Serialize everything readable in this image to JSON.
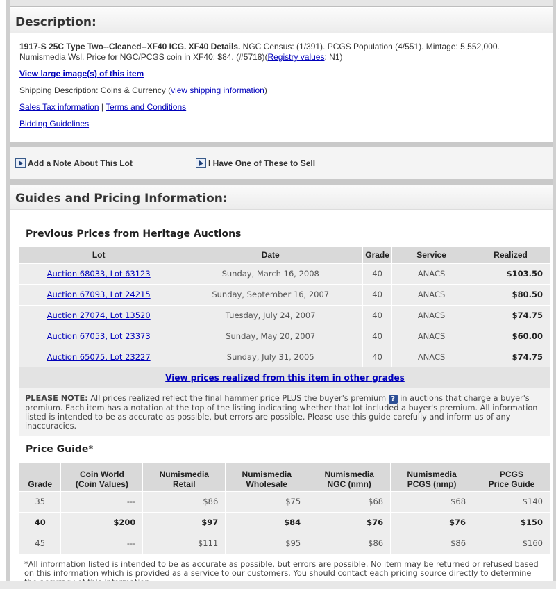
{
  "description": {
    "title": "Description:",
    "lot_title": "1917-S 25C Type Two--Cleaned--XF40 ICG. XF40 Details.",
    "census_text": " NGC Census: (1/391). PCGS Population (4/551). Mintage: 5,552,000. Numismedia Wsl. Price for NGC/PCGS coin in XF40: $84. (#5718)(",
    "registry_link": "Registry values",
    "registry_tail": ": N1)",
    "view_large_image": "View large image(s) of this item",
    "shipping_prefix": "Shipping Description: Coins & Currency (",
    "shipping_link": "view shipping information",
    "shipping_suffix": ")",
    "sales_tax_link": "Sales Tax information",
    "divider": " | ",
    "terms_link": "Terms and Conditions",
    "bidding_link": "Bidding Guidelines"
  },
  "actions": {
    "add_note": "Add a Note About This Lot",
    "have_one": "I Have One of These to Sell"
  },
  "guides": {
    "title": "Guides and Pricing Information:",
    "previous_prices_title": "Previous Prices from Heritage Auctions",
    "columns": [
      "Lot",
      "Date",
      "Grade",
      "Service",
      "Realized"
    ],
    "rows": [
      {
        "lot": "Auction 68033, Lot 63123",
        "date": "Sunday, March 16, 2008",
        "grade": "40",
        "service": "ANACS",
        "realized": "$103.50"
      },
      {
        "lot": "Auction 67093, Lot 24215",
        "date": "Sunday, September 16, 2007",
        "grade": "40",
        "service": "ANACS",
        "realized": "$80.50"
      },
      {
        "lot": "Auction 27074, Lot 13520",
        "date": "Tuesday, July 24, 2007",
        "grade": "40",
        "service": "ANACS",
        "realized": "$74.75"
      },
      {
        "lot": "Auction 67053, Lot 23373",
        "date": "Sunday, May 20, 2007",
        "grade": "40",
        "service": "ANACS",
        "realized": "$60.00"
      },
      {
        "lot": "Auction 65075, Lot 23227",
        "date": "Sunday, July 31, 2005",
        "grade": "40",
        "service": "ANACS",
        "realized": "$74.75"
      }
    ],
    "other_grades_link": "View prices realized from this item in other grades",
    "note_label": "PLEASE NOTE:",
    "note_text_1": " All prices realized reflect the final hammer price PLUS the buyer's premium ",
    "note_badge": "?",
    "note_text_2": " in auctions that charge a buyer's premium. Each item has a notation at the top of the listing indicating whether that lot included a buyer's premium. All information listed is intended to be as accurate as possible, but errors are possible. Please use this guide carefully and inform us of any inaccuracies.",
    "price_guide_title": "Price Guide",
    "price_guide_star": "*",
    "pg_columns": [
      {
        "line1": "",
        "line2": "Grade"
      },
      {
        "line1": "Coin World",
        "line2": "(Coin Values)"
      },
      {
        "line1": "Numismedia",
        "line2": "Retail"
      },
      {
        "line1": "Numismedia",
        "line2": "Wholesale"
      },
      {
        "line1": "Numismedia",
        "line2": "NGC (nmn)"
      },
      {
        "line1": "Numismedia",
        "line2": "PCGS (nmp)"
      },
      {
        "line1": "PCGS",
        "line2": "Price Guide"
      }
    ],
    "pg_rows": [
      {
        "grade": "35",
        "cw": "---",
        "retail": "$86",
        "wholesale": "$75",
        "ngc": "$68",
        "pcgs_nmp": "$68",
        "pcgs": "$140"
      },
      {
        "grade": "40",
        "cw": "$200",
        "retail": "$97",
        "wholesale": "$84",
        "ngc": "$76",
        "pcgs_nmp": "$76",
        "pcgs": "$150"
      },
      {
        "grade": "45",
        "cw": "---",
        "retail": "$111",
        "wholesale": "$95",
        "ngc": "$86",
        "pcgs_nmp": "$86",
        "pcgs": "$160"
      }
    ],
    "footnote": "*All information listed is intended to be as accurate as possible, but errors are possible. No item may be returned or refused based on this information which is provided as a service to our customers. You should contact each pricing source directly to determine the accuracy of this information."
  }
}
